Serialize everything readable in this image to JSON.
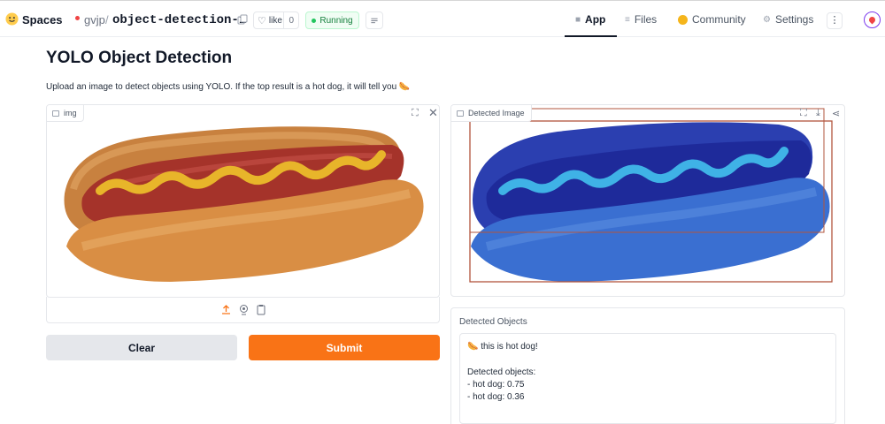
{
  "header": {
    "spaces_label": "Spaces",
    "owner": "gvjp",
    "separator": "/",
    "repo_name": "object-detection-1",
    "like_label": "like",
    "like_count": "0",
    "status": "Running",
    "tabs": [
      {
        "label": "App",
        "icon": "app-icon",
        "active": true
      },
      {
        "label": "Files",
        "icon": "files-icon",
        "active": false
      },
      {
        "label": "Community",
        "icon": "community-icon",
        "active": false
      },
      {
        "label": "Settings",
        "icon": "gear-icon",
        "active": false
      }
    ],
    "more_label": "⋮"
  },
  "main": {
    "title": "YOLO Object Detection",
    "description": "Upload an image to detect objects using YOLO. If the top result is a hot dog, it will tell you 🌭"
  },
  "input_panel": {
    "label": "img",
    "source_icons": [
      "upload-icon",
      "webcam-icon",
      "clipboard-icon"
    ]
  },
  "output_image_panel": {
    "label": "Detected Image"
  },
  "buttons": {
    "clear": "Clear",
    "submit": "Submit"
  },
  "output_text": {
    "label": "Detected Objects",
    "lines": [
      "🌭 this is hot dog!",
      "",
      "Detected objects:",
      "- hot dog: 0.75",
      "- hot dog: 0.36"
    ]
  },
  "colors": {
    "accent": "#f97316",
    "running": "#15803d",
    "bbox": "#b2543d"
  }
}
